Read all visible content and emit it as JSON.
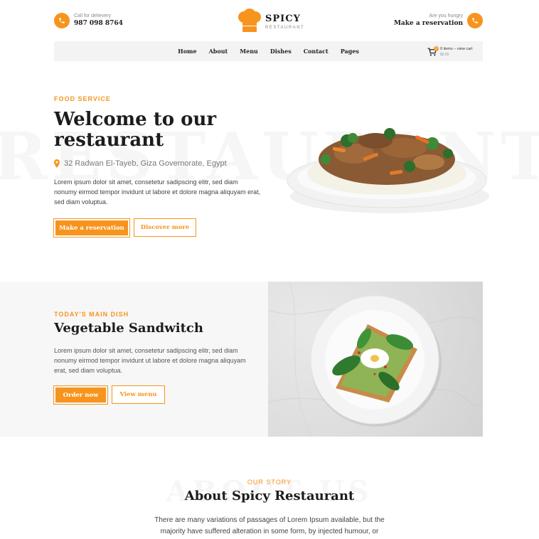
{
  "header": {
    "delivery_label": "Call for delievery",
    "delivery_phone": "987 098 8764",
    "brand_name": "SPICY",
    "brand_sub": "RESTAURANT",
    "hungry_label": "Are you hungry",
    "reservation_link": "Make a reservation"
  },
  "nav": {
    "items": [
      "Home",
      "About",
      "Menu",
      "Dishes",
      "Contact",
      "Pages"
    ],
    "cart_count": "0",
    "cart_title": "0 items – view cart",
    "cart_total": "$0.00"
  },
  "hero": {
    "background_word": "RESTAURANT",
    "eyebrow": "FOOD SERVICE",
    "title_line1": "Welcome to our",
    "title_line2": "restaurant",
    "address": "32 Radwan El-Tayeb, Giza Governorate, Egypt",
    "description": "Lorem ipsum dolor sit amet, consetetur sadipscing elitr, sed diam nonumy eirmod tempor invidunt ut labore et dolore magna aliquyam erat, sed diam voluptua.",
    "primary_button": "Make a reservation",
    "secondary_button": "Discover more"
  },
  "main_dish": {
    "eyebrow": "TODAY'S MAIN DISH",
    "title": "Vegetable Sandwitch",
    "description": "Lorem ipsum dolor sit amet, consetetur sadipscing elitr, sed diam nonumy eirmod tempor invidunt ut labore et dolore magna aliquyam erat, sed diam voluptua.",
    "primary_button": "Order now",
    "secondary_button": "View menu"
  },
  "about": {
    "background_word": "ABOUT US",
    "eyebrow": "OUR STORY",
    "title": "About Spicy Restaurant",
    "text_line1": "There are many variations of passages of Lorem Ipsum available, but the",
    "text_line2": "majority have suffered alteration in some form, by injected humour, or"
  },
  "colors": {
    "accent": "#f7941d",
    "dark_text": "#1c1c1c",
    "panel_grey": "#f7f7f7"
  },
  "icons": [
    "phone-icon",
    "chef-hat-icon",
    "cart-icon",
    "map-pin-icon"
  ]
}
